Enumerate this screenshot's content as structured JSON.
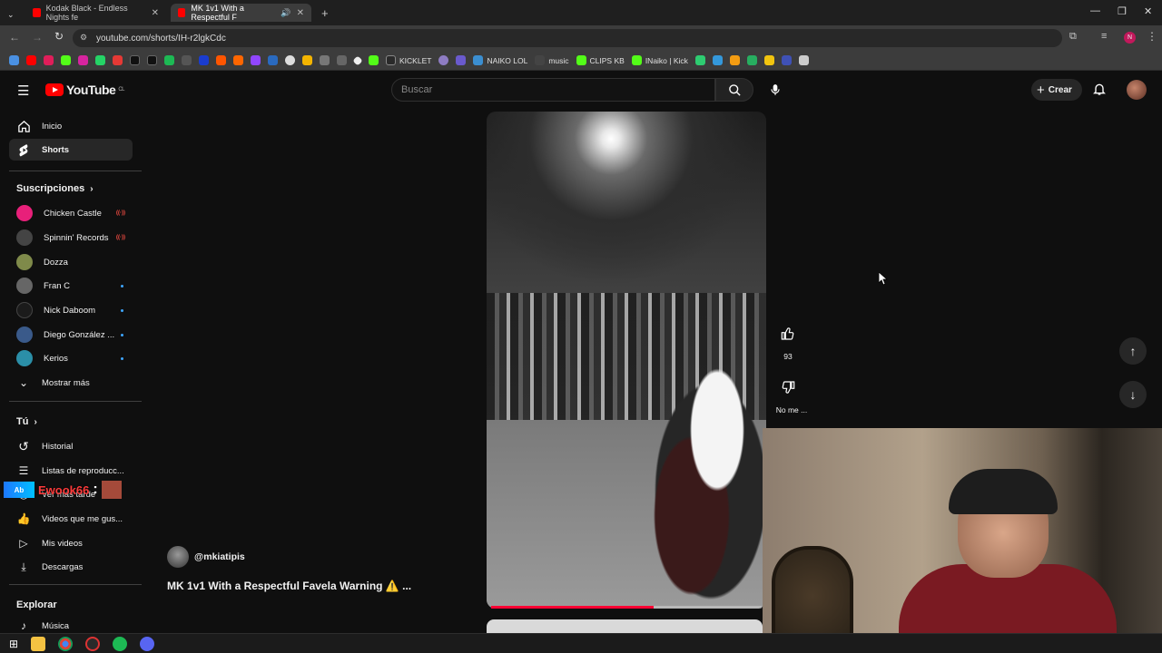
{
  "browser": {
    "tabs": [
      {
        "title": "Kodak Black - Endless Nights fe",
        "active": false
      },
      {
        "title": "MK 1v1 With a Respectful F",
        "active": true
      }
    ],
    "new_tab": "+",
    "url": "youtube.com/shorts/IH-r2lgkCdc",
    "bookmarks": [
      {
        "label": "KICKLET"
      },
      {
        "label": "NAIKO LOL"
      },
      {
        "label": "music"
      },
      {
        "label": "CLIPS KB"
      },
      {
        "label": "INaiko | Kick"
      }
    ]
  },
  "header": {
    "logo_text": "YouTube",
    "logo_country": "CL",
    "search_placeholder": "Buscar",
    "create_label": "Crear"
  },
  "sidebar": {
    "top": [
      {
        "label": "Inicio",
        "icon": "home-icon",
        "active": false
      },
      {
        "label": "Shorts",
        "icon": "shorts-icon",
        "active": true
      }
    ],
    "subscriptions_title": "Suscripciones",
    "subscriptions": [
      {
        "label": "Chicken Castle",
        "color": "#e8207a",
        "live": true
      },
      {
        "label": "Spinnin' Records",
        "color": "#444444",
        "live": true
      },
      {
        "label": "Dozza",
        "color": "#7f8a4a",
        "live": false
      },
      {
        "label": "Fran C",
        "color": "#666666",
        "live": false,
        "dot": true
      },
      {
        "label": "Nick Daboom",
        "color": "#1b1b1b",
        "live": false,
        "dot": true
      },
      {
        "label": "Diego González ...",
        "color": "#3a5a8a",
        "live": false,
        "dot": true
      },
      {
        "label": "Kerios",
        "color": "#2b8fa8",
        "live": false,
        "dot": true
      }
    ],
    "live_badge": "((·))",
    "show_more": "Mostrar más",
    "you_title": "Tú",
    "you_items": [
      {
        "label": "Historial",
        "icon": "history-icon"
      },
      {
        "label": "Listas de reproducc...",
        "icon": "playlist-icon"
      },
      {
        "label": "Ver más tarde",
        "icon": "clock-icon"
      },
      {
        "label": "Videos que me gus...",
        "icon": "like-icon"
      },
      {
        "label": "Mis videos",
        "icon": "video-icon"
      },
      {
        "label": "Descargas",
        "icon": "download-icon"
      }
    ],
    "explore_title": "Explorar",
    "explore_items": [
      {
        "label": "Música",
        "icon": "music-icon"
      }
    ]
  },
  "short": {
    "channel": "@mkiatipis",
    "title": "MK 1v1 With a Respectful Favela Warning ⚠️ ...",
    "likes": "93",
    "dislike_label": "No me ...",
    "progress": 0.6
  },
  "overlay": {
    "name": "Ewook66",
    "badge": "Ab"
  },
  "colors": {
    "youtube_red": "#ff0000",
    "progress_red": "#ff0033",
    "live_red": "#ff4e45",
    "new_dot_blue": "#3ea6ff"
  }
}
